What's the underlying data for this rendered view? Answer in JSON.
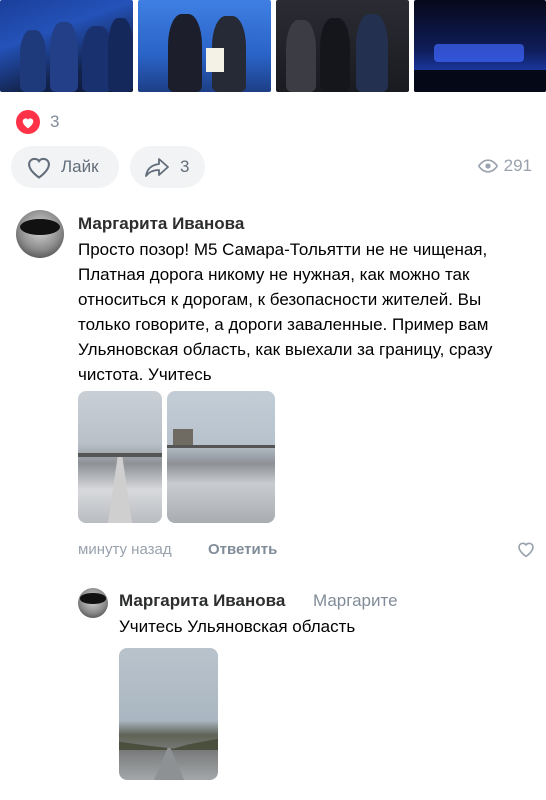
{
  "post": {
    "reaction_count": "3",
    "like_label": "Лайк",
    "share_count": "3",
    "views": "291"
  },
  "comments": [
    {
      "author": "Маргарита Иванова",
      "text": "Просто позор! М5 Самара-Тольятти не не чищеная, Платная дорога никому не нужная, как можно так относиться к дорогам, к безопасности жителей. Вы только говорите, а дороги заваленные. Пример вам Ульяновская область, как выехали за границу, сразу чистота. Учитесь",
      "time": "минуту назад",
      "reply_label": "Ответить"
    },
    {
      "author": "Маргарита Иванова",
      "reply_to": "Маргарите",
      "text": "Учитесь Ульяновская область"
    }
  ],
  "colors": {
    "reaction_heart": "#ff3347",
    "secondary_text": "#818c99",
    "pill_bg": "#f2f3f5"
  },
  "icons": [
    "heart-icon",
    "share-icon",
    "eye-icon",
    "like-heart-outline-icon"
  ]
}
